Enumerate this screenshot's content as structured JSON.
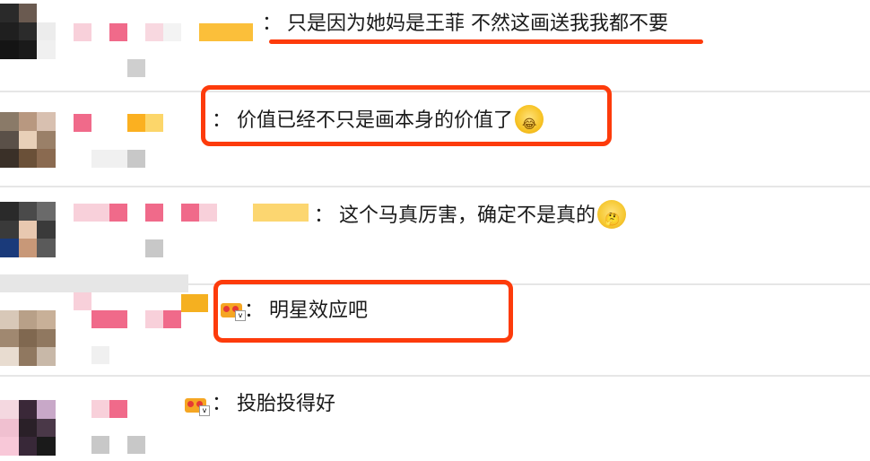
{
  "colors": {
    "annotation_red": "#fd3b0b",
    "separator": "#e6e6e6",
    "text": "#1a1a1a"
  },
  "separator_char": "：",
  "comments": [
    {
      "text": "只是因为她妈是王菲 不然这画送我我都不要",
      "emoji": "",
      "annotation": "underline"
    },
    {
      "text": "价值已经不只是画本身的价值了",
      "emoji": "cry-laugh-emoji",
      "annotation": "box"
    },
    {
      "text": "这个马真厉害，确定不是真的",
      "emoji": "thinking-emoji",
      "annotation": "none"
    },
    {
      "text": "明星效应吧",
      "emoji": "",
      "annotation": "box"
    },
    {
      "text": "投胎投得好",
      "emoji": "",
      "annotation": "none"
    }
  ],
  "icons": {
    "vip_badge": "crown-vip-icon"
  }
}
